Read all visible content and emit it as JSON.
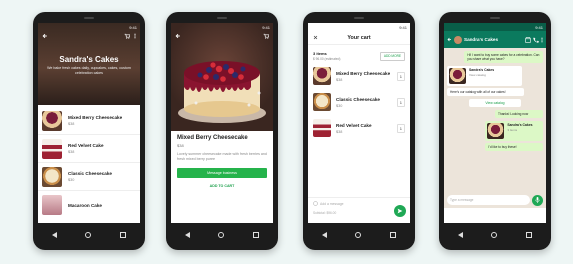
{
  "status_time": "9:41",
  "phone1": {
    "store_name": "Sandra's Cakes",
    "store_desc": "We bake fresh cakes daily, cupcakes, cakes, custom celebration cakes",
    "items": [
      {
        "name": "Mixed Berry Cheesecake",
        "price": "$38"
      },
      {
        "name": "Red Velvet Cake",
        "price": "$38"
      },
      {
        "name": "Classic Cheesecake",
        "price": "$30"
      },
      {
        "name": "Macaroon Cake",
        "price": ""
      }
    ]
  },
  "phone2": {
    "product_name": "Mixed Berry Cheesecake",
    "price": "$38",
    "description": "Lovely summer cheesecake made with fresh berries and fresh mixed berry puree",
    "primary_button": "Message business",
    "secondary_button": "ADD TO CART"
  },
  "phone3": {
    "title": "Your cart",
    "item_count": "3 items",
    "estimate": "$ 96.00 (estimated)",
    "add_more": "ADD MORE",
    "items": [
      {
        "name": "Mixed Berry Cheesecake",
        "price": "$38",
        "qty": "1"
      },
      {
        "name": "Classic Cheesecake",
        "price": "$30",
        "qty": "1"
      },
      {
        "name": "Red Velvet Cake",
        "price": "$38",
        "qty": "1"
      }
    ],
    "message_placeholder": "Add a message",
    "subtotal": "Subtotal: $96.00"
  },
  "phone4": {
    "contact": "Sandra's Cakes",
    "msg1": "Hi! I want to buy some cakes for a celebration. Can you share what you have?",
    "card1_name": "Sandra's Cakes",
    "card1_desc": "View catalog",
    "msg2": "Here's our catalog with all of our cakes!",
    "view_catalog": "View catalog",
    "msg3": "Thanks! Looking now",
    "card2_name": "Sandra's Cakes",
    "card2_desc": "3 items",
    "msg4": "I'd like to buy these!",
    "input_placeholder": "Type a message"
  },
  "colors": {
    "accent_green": "#1fa855",
    "whatsapp_header": "#0b7a5e",
    "chat_bg": "#ece4da"
  }
}
